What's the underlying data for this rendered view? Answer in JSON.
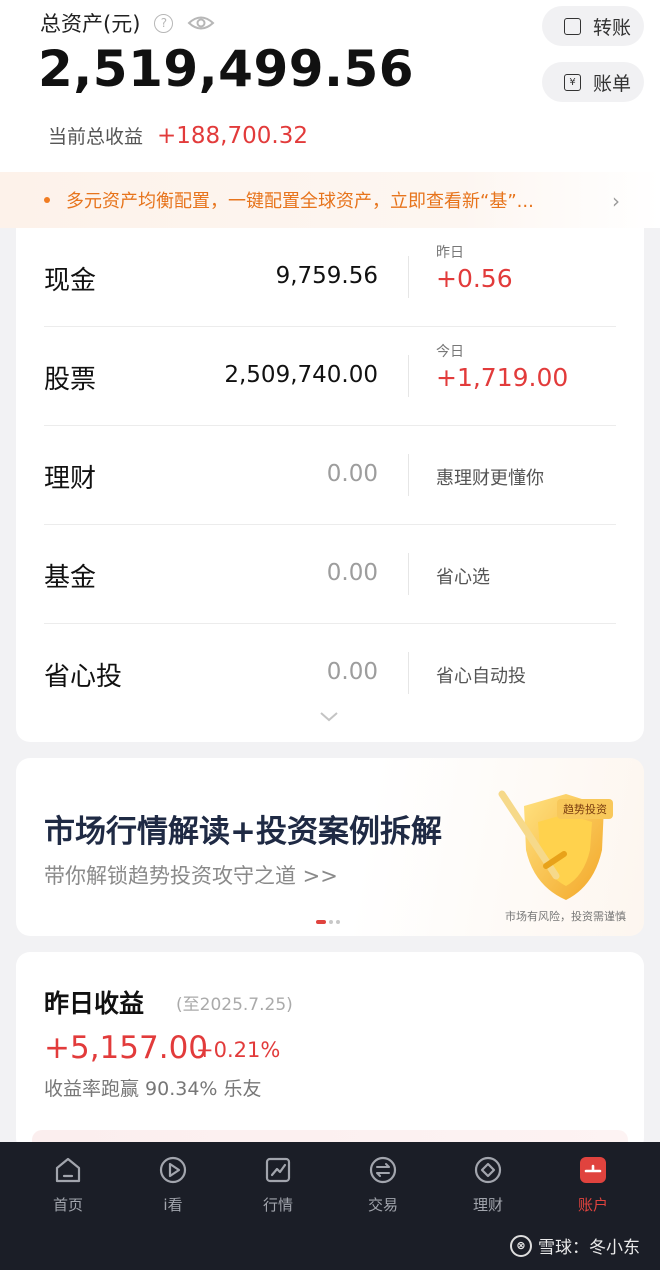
{
  "header": {
    "total_label": "总资产(元)",
    "help_icon": "?",
    "total_value": "2,519,499.56",
    "profit_label": "当前总收益",
    "profit_value": "+188,700.32",
    "transfer_label": "转账",
    "bill_label": "账单",
    "bill_icon_glyph": "¥"
  },
  "banner": {
    "text": "多元资产均衡配置，一键配置全球资产，立即查看新“基”...",
    "arrow": "›"
  },
  "assets": [
    {
      "name": "现金",
      "amount": "9,759.56",
      "sub": "昨日",
      "change": "+0.56"
    },
    {
      "name": "股票",
      "amount": "2,509,740.00",
      "sub": "今日",
      "change": "+1,719.00"
    },
    {
      "name": "理财",
      "amount": "0.00",
      "desc": "惠理财更懂你"
    },
    {
      "name": "基金",
      "amount": "0.00",
      "desc": "省心选"
    },
    {
      "name": "省心投",
      "amount": "0.00",
      "desc": "省心自动投"
    }
  ],
  "promo": {
    "title": "市场行情解读+投资案例拆解",
    "subtitle": "带你解锁趋势投资攻守之道 >>",
    "tag": "趋势投资",
    "risk": "市场有风险，投资需谨慎"
  },
  "yesterday": {
    "title": "昨日收益",
    "date": "(至2025.7.25)",
    "value": "+5,157.00",
    "rate": "+0.21%",
    "beat": "收益率跑赢 90.34% 乐友"
  },
  "tabs": [
    {
      "label": "首页",
      "icon": "home-icon"
    },
    {
      "label": "i看",
      "icon": "play-icon"
    },
    {
      "label": "行情",
      "icon": "chart-icon"
    },
    {
      "label": "交易",
      "icon": "exchange-icon"
    },
    {
      "label": "理财",
      "icon": "diamond-icon"
    },
    {
      "label": "账户",
      "icon": "account-icon"
    }
  ],
  "watermark": {
    "logo": "⊗",
    "text": "雪球：冬小东"
  },
  "colors": {
    "up_red": "#e23b3b",
    "banner_orange": "#e7741c",
    "tab_active": "#e0433e",
    "tabbar_bg": "#1b1e27"
  }
}
